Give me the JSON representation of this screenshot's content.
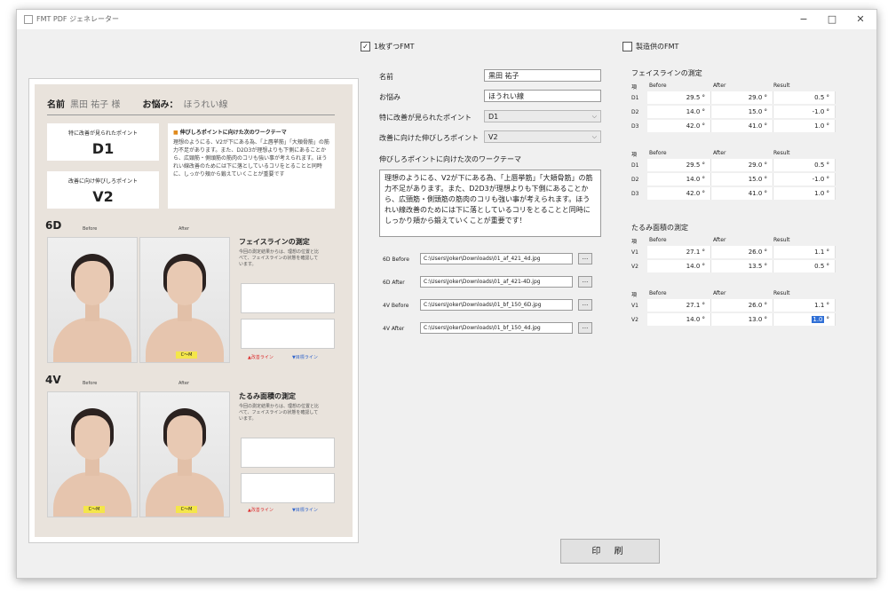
{
  "window": {
    "title": "FMT PDF ジェネレーター",
    "minimize": "−",
    "maximize": "□",
    "close": "✕"
  },
  "checks": {
    "per_page": {
      "label": "1枚ずつFMT",
      "checked": true
    },
    "simultaneous": {
      "label": "製造供のFMT",
      "checked": false
    }
  },
  "preview": {
    "name_label": "名前",
    "name_value": "黒田 祐子 様",
    "concern_label": "お悩み：",
    "concern_value": "ほうれい線",
    "improved_caption": "特に改善が見られたポイント",
    "improved_value": "D1",
    "stretch_caption": "改善に向け伸びしろポイント",
    "stretch_value": "V2",
    "theme_title": "伸びしろポイントに向けた次のワークテーマ",
    "theme_text": "理想のようにる、V2が下にある為、「上唇挙筋」「大頬骨筋」の筋力不足があります。また、D2D3が理想よりも下側にあることから、広頸筋・側頭筋の筋肉のコリも強い事が考えられます。ほうれい線改善のためには下に落としているコリをとることと同時に、しっかり頬から鍛えていくことが重要です",
    "sec1": "6D",
    "sec2": "4V",
    "before": "Before",
    "after": "After",
    "meas1_title": "フェイスラインの測定",
    "meas2_title": "たるみ面積の測定",
    "meas_text": "今回の測定結果からは、理想の位置と比べて、フェイスラインの状態を確認しています。",
    "chin_tag": "C～M",
    "legend_down": "▲改善ライン",
    "legend_up": "▼目標ライン"
  },
  "form": {
    "name_label": "名前",
    "name_value": "黒田 祐子",
    "concern_label": "お悩み",
    "concern_value": "ほうれい線",
    "improved_label": "特に改善が見られたポイント",
    "improved_value": "D1",
    "stretch_label": "改善に向けた伸びしろポイント",
    "stretch_value": "V2",
    "theme_label": "伸びしろポイントに向けた次のワークテーマ",
    "theme_value": "理想のようにる、V2が下にある為、「上唇挙筋」「大頬骨筋」の筋力不足があります。また、D2D3が理想よりも下側にあることから、広頸筋・側頭筋の筋肉のコリも強い事が考えられます。ほうれい線改善のためには下に落としているコリをとることと同時にしっかり頬から鍛えていくことが重要です！"
  },
  "files": [
    {
      "label": "6D Before",
      "path": "C:\\Users\\Joker\\Downloads\\01_af_421_4d.jpg"
    },
    {
      "label": "6D After",
      "path": "C:\\Users\\Joker\\Downloads\\01_af_421-4D.jpg"
    },
    {
      "label": "4V Before",
      "path": "C:\\Users\\Joker\\Downloads\\01_bf_150_6D.jpg"
    },
    {
      "label": "4V After",
      "path": "C:\\Users\\Joker\\Downloads\\01_bf_150_4d.jpg"
    }
  ],
  "browse_label": "...",
  "print_label": "印 刷",
  "measurements": {
    "face_title": "フェイスラインの測定",
    "sag_title": "たるみ面積の測定",
    "headers": {
      "id": "項",
      "before": "Before",
      "after": "After",
      "result": "Result"
    },
    "table1": [
      {
        "id": "D1",
        "before": "29.5 °",
        "after": "29.0 °",
        "result": "0.5 °"
      },
      {
        "id": "D2",
        "before": "14.0 °",
        "after": "15.0 °",
        "result": "-1.0 °"
      },
      {
        "id": "D3",
        "before": "42.0 °",
        "after": "41.0 °",
        "result": "1.0 °"
      }
    ],
    "table2": [
      {
        "id": "D1",
        "before": "29.5 °",
        "after": "29.0 °",
        "result": "0.5 °"
      },
      {
        "id": "D2",
        "before": "14.0 °",
        "after": "15.0 °",
        "result": "-1.0 °"
      },
      {
        "id": "D3",
        "before": "42.0 °",
        "after": "41.0 °",
        "result": "1.0 °"
      }
    ],
    "table3": [
      {
        "id": "V1",
        "before": "27.1 °",
        "after": "26.0 °",
        "result": "1.1 °"
      },
      {
        "id": "V2",
        "before": "14.0 °",
        "after": "13.5 °",
        "result": "0.5 °"
      }
    ],
    "table4": [
      {
        "id": "V1",
        "before": "27.1 °",
        "after": "26.0 °",
        "result": "1.1 °"
      },
      {
        "id": "V2",
        "before": "14.0 °",
        "after": "13.0 °",
        "result": "1.0",
        "result_unit": "°"
      }
    ]
  }
}
